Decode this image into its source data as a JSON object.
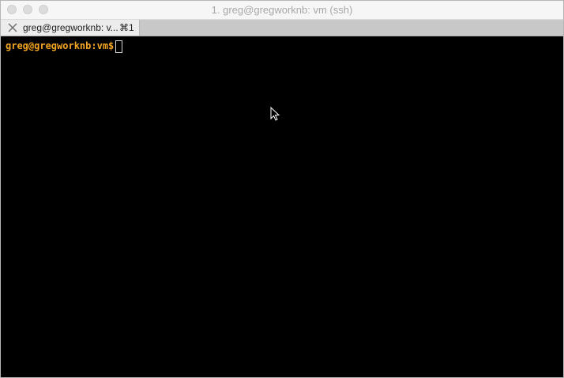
{
  "window": {
    "title": "1. greg@gregworknb: vm (ssh)"
  },
  "tabs": [
    {
      "label": "greg@gregworknb: v...",
      "shortcut": "⌘1",
      "close_icon": "close-x-icon"
    }
  ],
  "terminal": {
    "prompt": "greg@gregworknb:vm$",
    "prompt_color": "#f5a623",
    "background": "#000000"
  },
  "icons": {
    "mouse_pointer": "arrow-pointer-icon"
  }
}
